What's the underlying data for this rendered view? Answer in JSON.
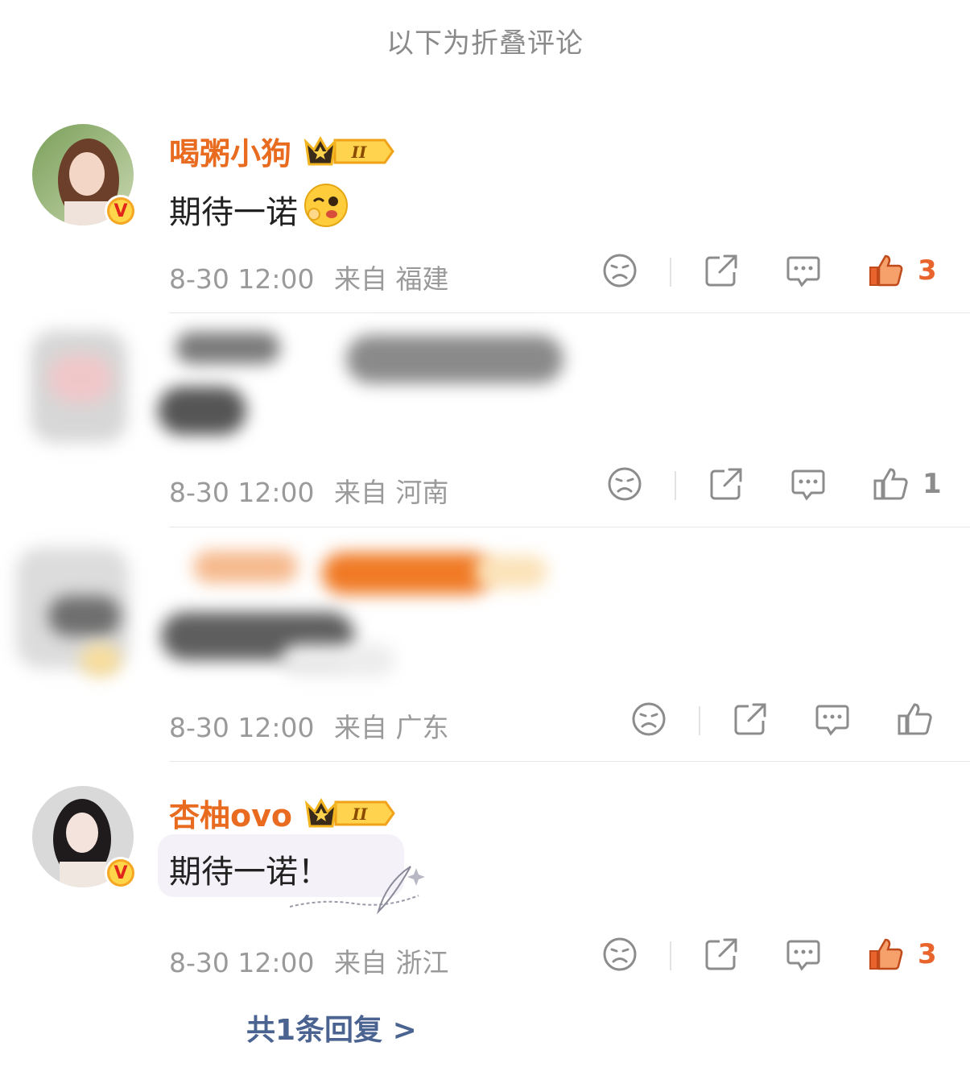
{
  "header": {
    "folded_label": "以下为折叠评论"
  },
  "comments": [
    {
      "username": "喝粥小狗",
      "level_badge": "II",
      "text": "期待一诺",
      "emoji": "wink-emoji",
      "date": "8-30 12:00",
      "location": "来自 福建",
      "likes": "3",
      "liked": true,
      "verified": true
    },
    {
      "username": "",
      "text": "",
      "blurred": true,
      "date": "8-30 12:00",
      "location": "来自 河南",
      "likes": "1",
      "liked": false
    },
    {
      "username": "",
      "text": "",
      "blurred": true,
      "date": "8-30 12:00",
      "location": "来自 广东",
      "likes": "",
      "liked": false
    },
    {
      "username": "杏柚ovo",
      "level_badge": "II",
      "text": "期待一诺！",
      "date": "8-30 12:00",
      "location": "来自 浙江",
      "likes": "3",
      "liked": true,
      "verified": true
    }
  ],
  "replies": {
    "label": "共1条回复 >"
  },
  "colors": {
    "username": "#e86b1f",
    "liked": "#e8642c",
    "icon_gray": "#8c8c8c",
    "reply_link": "#4a6390",
    "meta": "#9a9a9a"
  },
  "icons": [
    "sad-face-icon",
    "share-icon",
    "comment-icon",
    "thumbs-up-icon",
    "crown-icon",
    "verified-v-icon"
  ]
}
